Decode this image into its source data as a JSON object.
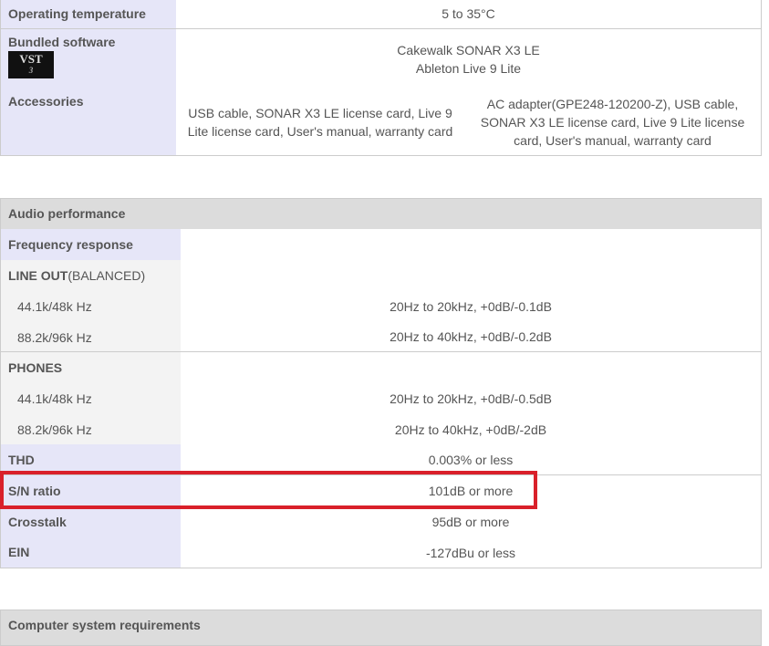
{
  "general": {
    "rows": [
      {
        "label": "Operating temperature",
        "value": "5 to 35°C"
      },
      {
        "label": "Bundled software",
        "value_lines": [
          "Cakewalk SONAR X3 LE",
          "Ableton Live 9 Lite"
        ],
        "logo": "VST 3"
      },
      {
        "label": "Accessories",
        "value_a": "USB cable, SONAR X3 LE license card, Live 9 Lite license card, User's manual, warranty card",
        "value_b": "AC adapter(GPE248-120200-Z), USB cable, SONAR X3 LE license card, Live 9 Lite license card, User's manual, warranty card"
      }
    ]
  },
  "audio": {
    "title": "Audio performance",
    "freq_label": "Frequency response",
    "line_out": {
      "label": "LINE OUT",
      "suffix": "(BALANCED)"
    },
    "line_rows": [
      {
        "label": "44.1k/48k Hz",
        "value": "20Hz to 20kHz, +0dB/-0.1dB"
      },
      {
        "label": "88.2k/96k Hz",
        "value": "20Hz to 40kHz, +0dB/-0.2dB"
      }
    ],
    "phones": {
      "label": "PHONES"
    },
    "phones_rows": [
      {
        "label": "44.1k/48k Hz",
        "value": "20Hz to 20kHz, +0dB/-0.5dB"
      },
      {
        "label": "88.2k/96k Hz",
        "value": "20Hz to 40kHz, +0dB/-2dB"
      }
    ],
    "thd": {
      "label": "THD",
      "value": "0.003% or less"
    },
    "sn": {
      "label": "S/N ratio",
      "value": "101dB or more"
    },
    "crosstalk": {
      "label": "Crosstalk",
      "value": "95dB or more"
    },
    "ein": {
      "label": "EIN",
      "value": "-127dBu or less"
    }
  },
  "computer": {
    "title": "Computer system requirements"
  },
  "highlight_color": "#d9202a"
}
